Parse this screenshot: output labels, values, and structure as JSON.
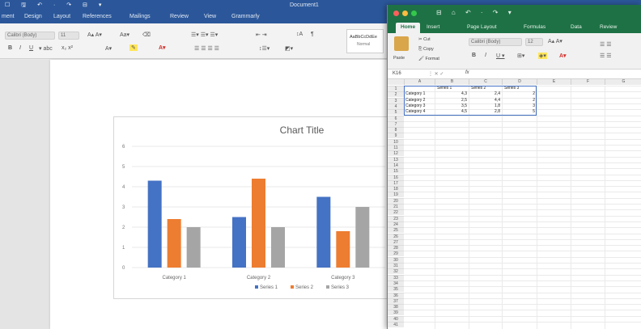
{
  "word": {
    "title": "Document1",
    "quick_access": "☐ 🖫 ↶ · ↷ ⊟ ▾",
    "tabs": [
      "ment",
      "Design",
      "Layout",
      "References",
      "Mailings",
      "Review",
      "View",
      "Grammarly"
    ],
    "font_name": "Calibri (Body)",
    "font_size": "11",
    "style_normal": "AaBbCcDdEe",
    "style_label": "Normal"
  },
  "chart_data": {
    "type": "bar",
    "title": "Chart Title",
    "categories": [
      "Category 1",
      "Category 2",
      "Category 3"
    ],
    "series": [
      {
        "name": "Series 1",
        "color": "#4472c4",
        "values": [
          4.3,
          2.5,
          3.5
        ]
      },
      {
        "name": "Series 2",
        "color": "#ed7d31",
        "values": [
          2.4,
          4.4,
          1.8
        ]
      },
      {
        "name": "Series 3",
        "color": "#a5a5a5",
        "values": [
          2,
          2,
          3
        ]
      }
    ],
    "yticks": [
      0,
      1,
      2,
      3,
      4,
      5,
      6
    ],
    "ylim": [
      0,
      6
    ],
    "grid": true,
    "legend": "bottom"
  },
  "excel": {
    "quick_access": "⊟ ⌂ ↶ · ↷ ▾",
    "tabs": [
      "Home",
      "Insert",
      "Page Layout",
      "Formulas",
      "Data",
      "Review"
    ],
    "clipboard": {
      "paste": "Paste",
      "cut": "Cut",
      "copy": "Copy",
      "format": "Format"
    },
    "font_name": "Calibri (Body)",
    "font_size": "12",
    "name_box": "K16",
    "fx": "fx",
    "columns": [
      "A",
      "B",
      "C",
      "D",
      "E",
      "F",
      "G"
    ],
    "sheet_header": [
      "Series 1",
      "Series 2",
      "Series 3"
    ],
    "rows": [
      [
        "Category 1",
        "4,3",
        "2,4",
        "2"
      ],
      [
        "Category 2",
        "2,5",
        "4,4",
        "2"
      ],
      [
        "Category 3",
        "3,5",
        "1,8",
        "3"
      ],
      [
        "Category 4",
        "4,5",
        "2,8",
        "5"
      ]
    ],
    "row_count": 41
  }
}
